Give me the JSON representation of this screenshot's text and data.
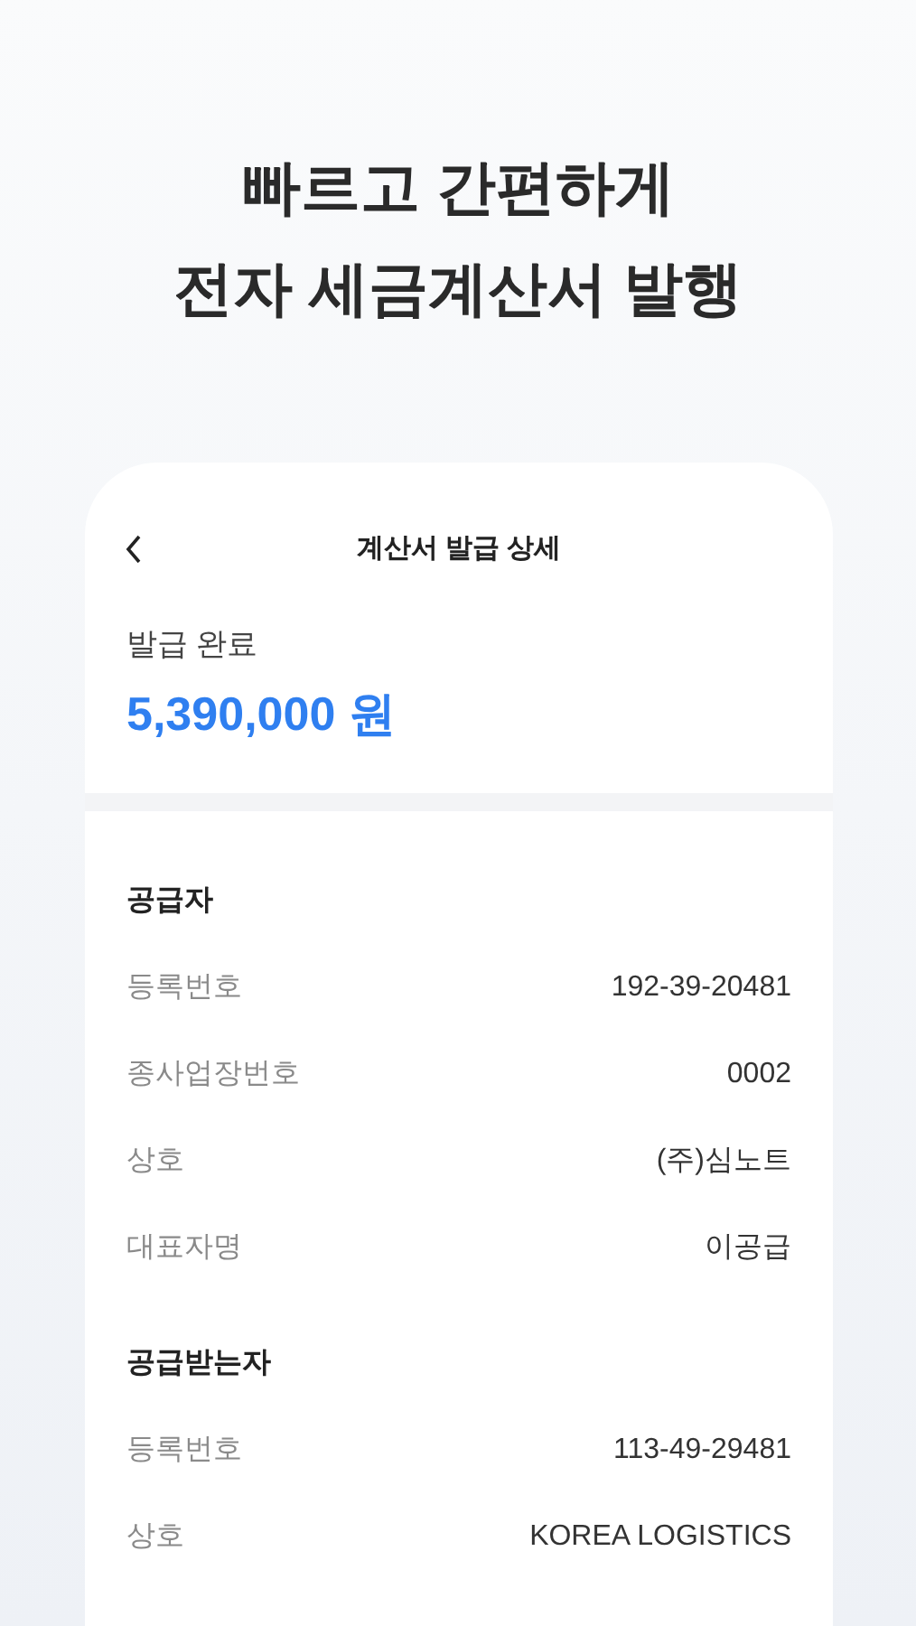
{
  "headline": [
    "빠르고 간편하게",
    "전자 세금계산서 발행"
  ],
  "screen": {
    "title": "계산서 발급 상세",
    "status": "발급 완료",
    "amount": "5,390,000 원",
    "sections": [
      {
        "heading": "공급자",
        "rows": [
          {
            "label": "등록번호",
            "value": "192-39-20481"
          },
          {
            "label": "종사업장번호",
            "value": "0002"
          },
          {
            "label": "상호",
            "value": "(주)심노트"
          },
          {
            "label": "대표자명",
            "value": "이공급"
          }
        ]
      },
      {
        "heading": "공급받는자",
        "rows": [
          {
            "label": "등록번호",
            "value": "113-49-29481"
          },
          {
            "label": "상호",
            "value": "KOREA LOGISTICS"
          }
        ]
      }
    ]
  }
}
